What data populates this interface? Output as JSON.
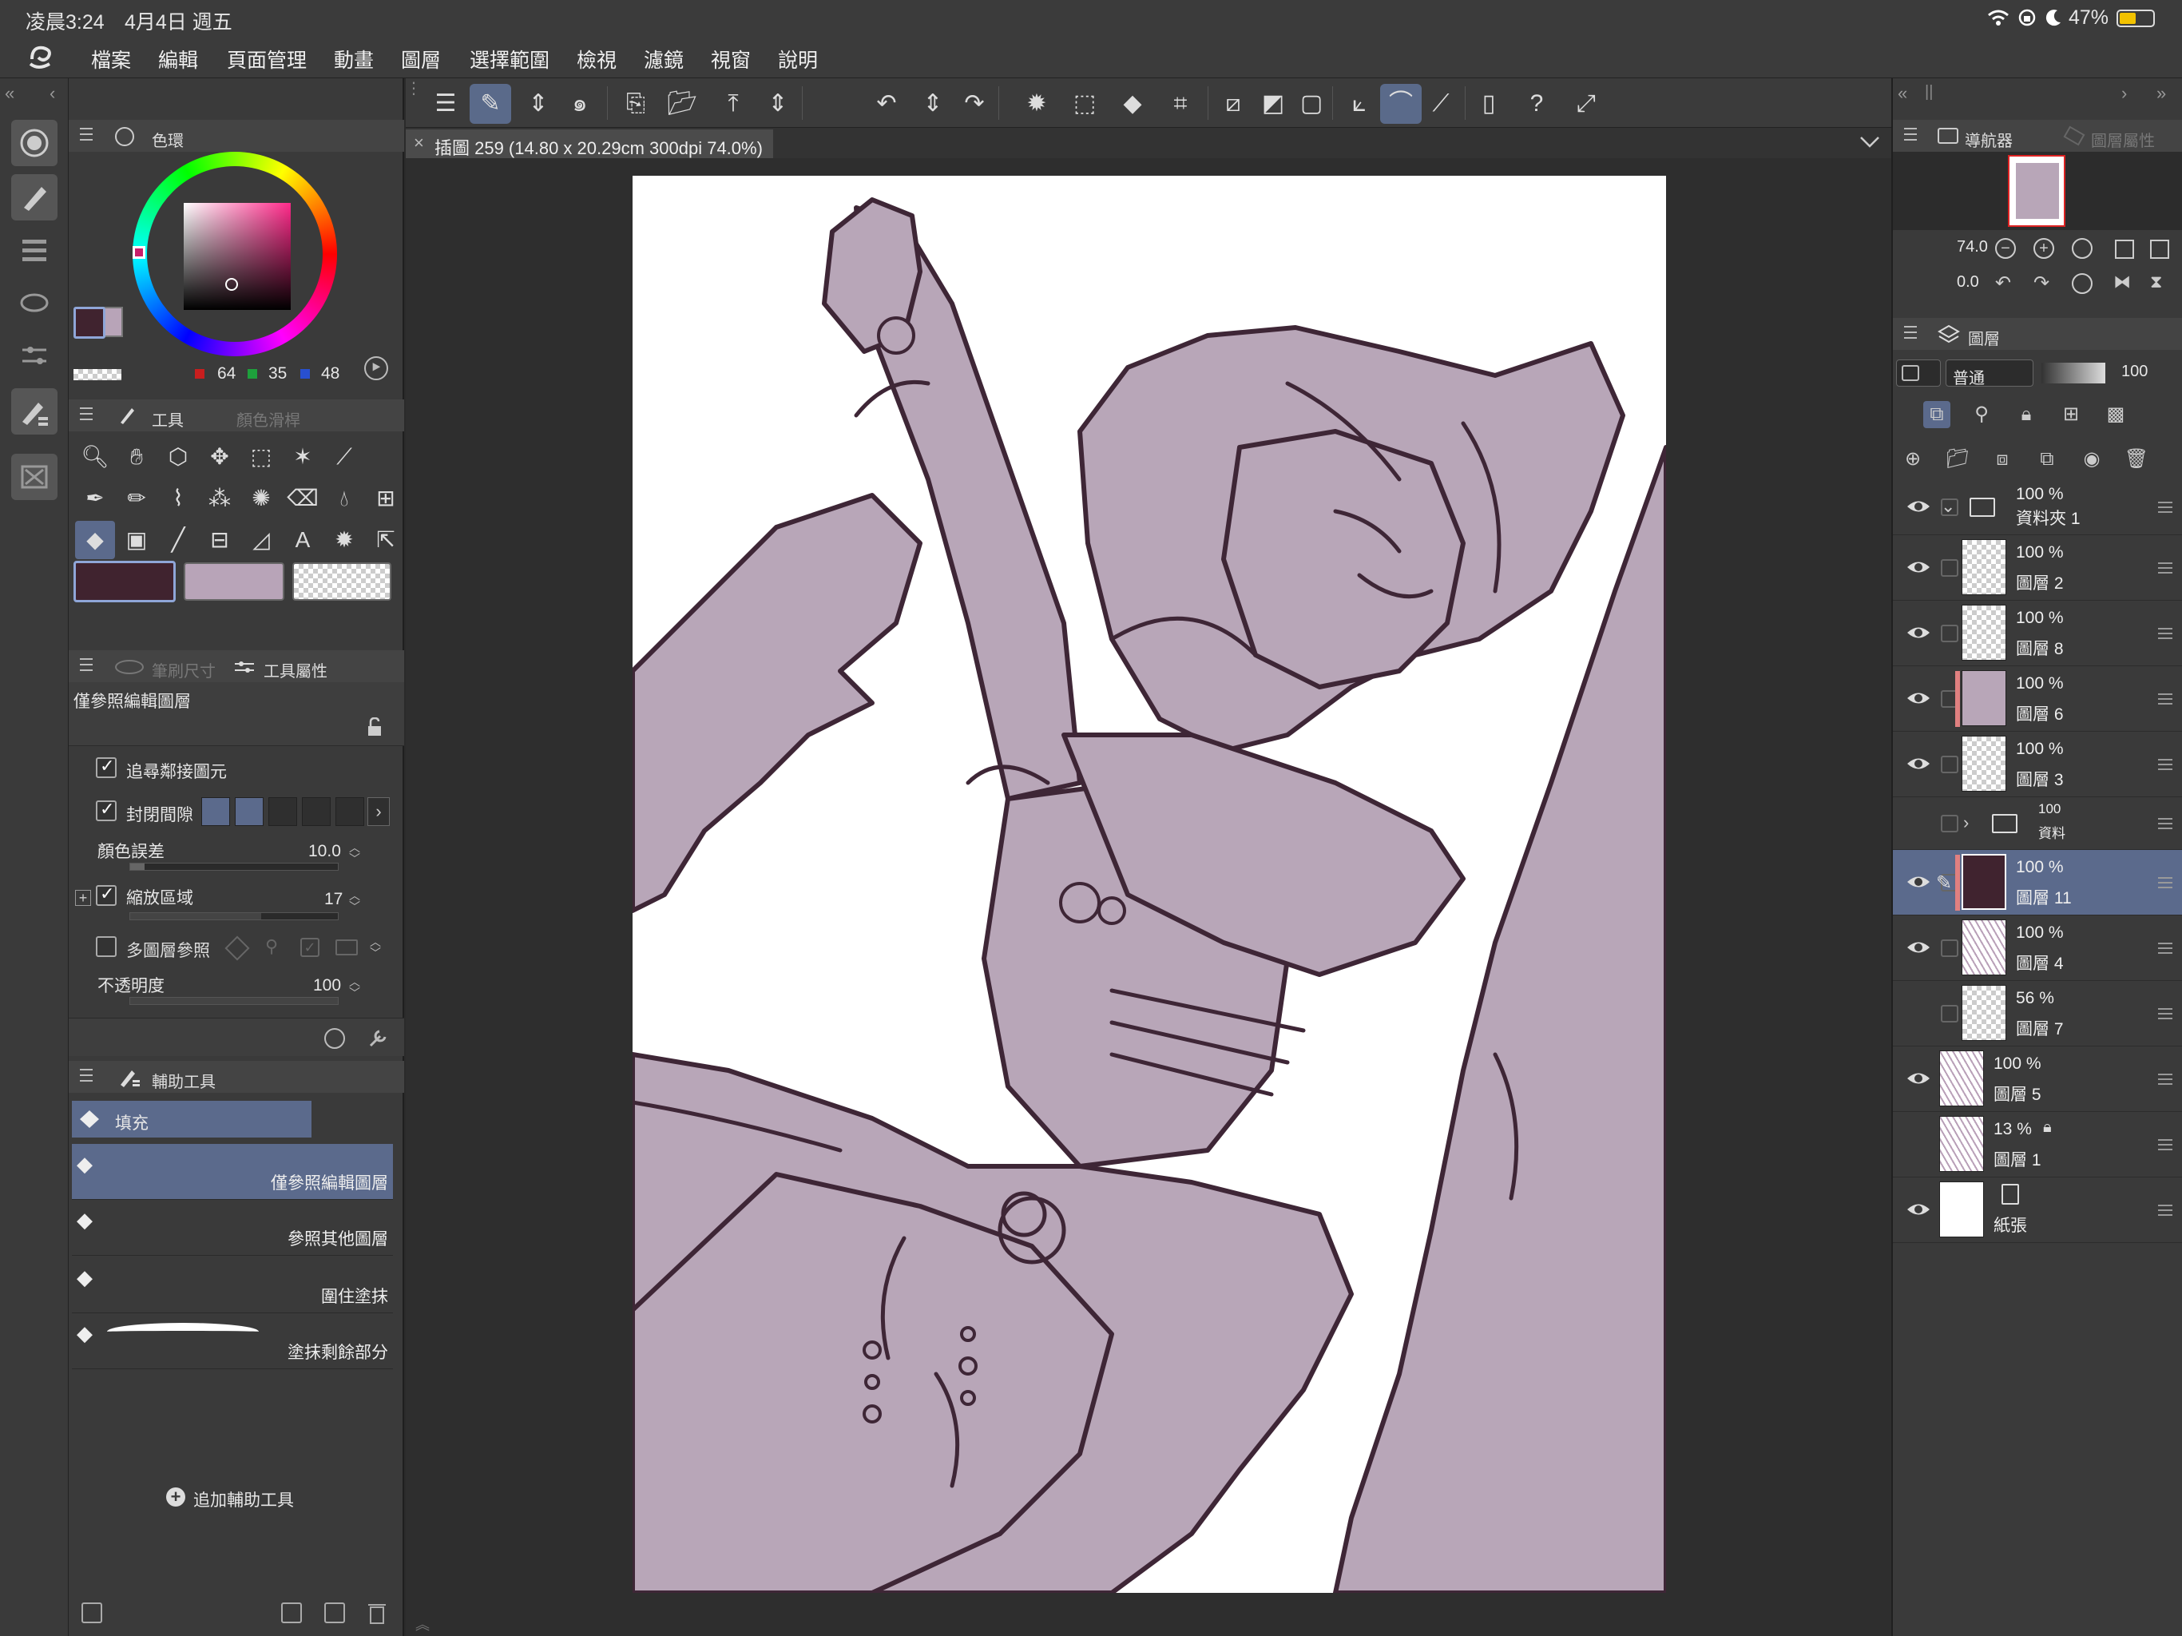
{
  "status": {
    "time": "凌晨3:24",
    "date": "4月4日 週五",
    "battery": "47%"
  },
  "menu": [
    "檔案",
    "編輯",
    "頁面管理",
    "動畫",
    "圖層",
    "選擇範圍",
    "檢視",
    "濾鏡",
    "視窗",
    "說明"
  ],
  "color_panel": {
    "title": "色環",
    "r": "64",
    "g": "35",
    "b": "48",
    "main_color": "#40232f",
    "sub_color": "#b8a4b8"
  },
  "tool_panel": {
    "tab_tool": "工具",
    "tab_color_slider": "顏色滑桿"
  },
  "props_panel": {
    "tab_brush_size": "筆刷尺寸",
    "tab_tool_props": "工具屬性",
    "subtool_name": "僅參照編輯圖層",
    "follow_adjacent": "追尋鄰接圖元",
    "close_gap": "封閉間隙",
    "color_margin_label": "顏色誤差",
    "color_margin_value": "10.0",
    "area_scaling_label": "縮放區域",
    "area_scaling_value": "17",
    "multi_layer_label": "多圖層參照",
    "opacity_label": "不透明度",
    "opacity_value": "100"
  },
  "subtool_panel": {
    "title": "輔助工具",
    "group": "填充",
    "items": [
      "僅參照編輯圖層",
      "參照其他圖層",
      "圍住塗抹",
      "塗抹剩餘部分"
    ],
    "add_label": "追加輔助工具"
  },
  "document_tab": {
    "title": "插圖 259 (14.80 x 20.29cm 300dpi 74.0%)"
  },
  "navigator": {
    "tab_navigator": "導航器",
    "tab_layer_props": "圖層屬性",
    "zoom": "74.0",
    "rotation": "0.0"
  },
  "layers_panel": {
    "title": "圖層",
    "blend_mode": "普通",
    "opacity": "100",
    "layers": [
      {
        "pct": "100 %",
        "name": "資料夾 1"
      },
      {
        "pct": "100 %",
        "name": "圖層 2"
      },
      {
        "pct": "100 %",
        "name": "圖層 8"
      },
      {
        "pct": "100 %",
        "name": "圖層 6"
      },
      {
        "pct": "100 %",
        "name": "圖層 3"
      },
      {
        "pct": "100",
        "name": "資料"
      },
      {
        "pct": "100 %",
        "name": "圖層 11"
      },
      {
        "pct": "100 %",
        "name": "圖層 4"
      },
      {
        "pct": "56 %",
        "name": "圖層 7"
      },
      {
        "pct": "100 %",
        "name": "圖層 5"
      },
      {
        "pct": "13 %",
        "name": "圖層 1"
      },
      {
        "pct": "",
        "name": "紙張"
      }
    ]
  },
  "colors": {
    "accent": "#5b6a8c",
    "fill": "#b8a6b8",
    "line": "#3e2636"
  }
}
